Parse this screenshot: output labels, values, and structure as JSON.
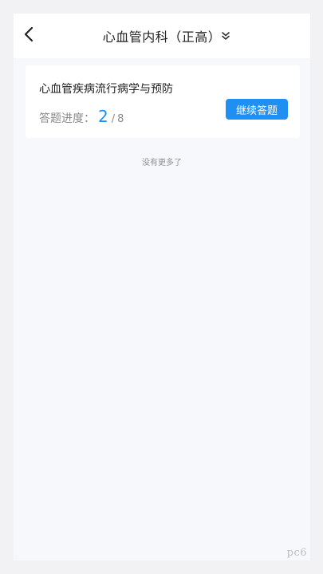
{
  "header": {
    "back_icon": "chevron-left-icon",
    "title": "心血管内科（正高）",
    "dropdown_icon": "double-chevron-down-icon"
  },
  "card": {
    "title": "心血管疾病流行病学与预防",
    "progress_label": "答题进度：",
    "progress_current": "2",
    "progress_separator": "/",
    "progress_total": "8",
    "progress_fraction": 0.25,
    "continue_label": "继续答题"
  },
  "footer": {
    "no_more": "没有更多了"
  },
  "watermark": "pc6",
  "colors": {
    "accent": "#1f8ff2",
    "progress_number": "#1890ff",
    "background": "#f7f8fc",
    "card": "#ffffff"
  }
}
